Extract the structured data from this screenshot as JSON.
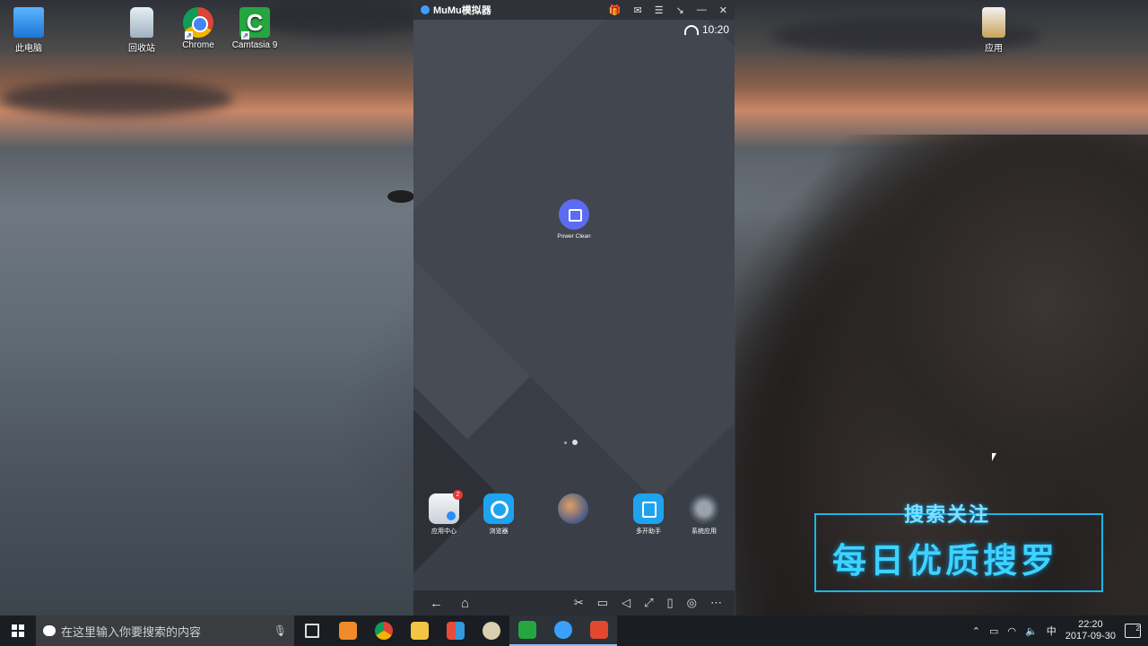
{
  "desktop": {
    "icons": [
      {
        "label": "此电脑",
        "icon": "computer-icon"
      },
      {
        "label": "回收站",
        "icon": "recycle-bin-icon"
      },
      {
        "label": "Chrome",
        "icon": "chrome-icon"
      },
      {
        "label": "Camtasia 9",
        "icon": "camtasia-icon"
      },
      {
        "label": "应用",
        "icon": "app-folder-icon"
      }
    ]
  },
  "emulator": {
    "brand": "MuMu模拟器",
    "title_controls": [
      "gift-icon",
      "mail-icon",
      "menu-icon",
      "shrink-icon",
      "minimize-icon",
      "close-icon"
    ],
    "status_time": "10:20",
    "home_app": {
      "label": "Power Clean",
      "icon": "power-clean-icon"
    },
    "dock": [
      {
        "label": "应用中心",
        "icon": "app-center-icon",
        "badge": "2"
      },
      {
        "label": "浏览器",
        "icon": "browser-icon"
      },
      {
        "label": "",
        "icon": "game-icon"
      },
      {
        "label": "多开助手",
        "icon": "multi-instance-icon"
      },
      {
        "label": "系统应用",
        "icon": "system-apps-icon"
      }
    ],
    "nav_left": [
      "←",
      "⌂"
    ],
    "nav_right": [
      "✂",
      "▭",
      "◁",
      "⤢",
      "▯",
      "◎",
      "⋯"
    ]
  },
  "promo": {
    "top_text": "搜索关注",
    "main_text": "每日优质搜罗",
    "accent": "#18b7e8"
  },
  "taskbar": {
    "search_placeholder": "在这里输入你要搜索的内容",
    "tray_lang": "中",
    "clock_time": "22:20",
    "clock_date": "2017-09-30",
    "notification_count": "2"
  }
}
